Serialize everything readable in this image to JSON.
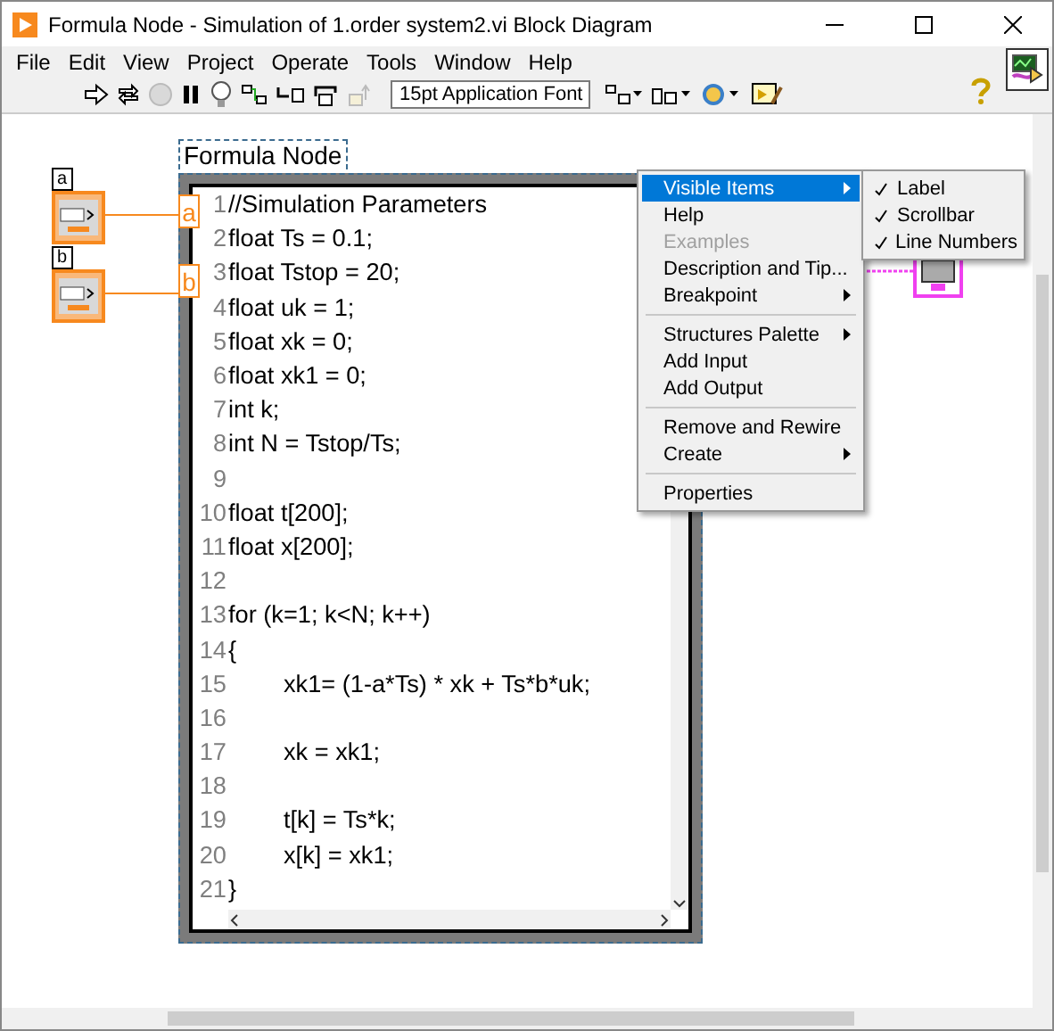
{
  "window": {
    "title": "Formula Node - Simulation of 1.order system2.vi Block Diagram"
  },
  "menu": [
    "File",
    "Edit",
    "View",
    "Project",
    "Operate",
    "Tools",
    "Window",
    "Help"
  ],
  "toolbar": {
    "font": "15pt Application Font"
  },
  "controls": [
    {
      "label": "a",
      "tunnel": "a"
    },
    {
      "label": "b",
      "tunnel": "b"
    }
  ],
  "formula_node": {
    "label": "Formula Node",
    "lines": [
      {
        "number": "1",
        "code": "//Simulation Parameters",
        "indent": false
      },
      {
        "number": "2",
        "code": "float Ts = 0.1;",
        "indent": false
      },
      {
        "number": "3",
        "code": "float Tstop = 20;",
        "indent": false
      },
      {
        "number": "4",
        "code": "float uk = 1;",
        "indent": false
      },
      {
        "number": "5",
        "code": "float xk = 0;",
        "indent": false
      },
      {
        "number": "6",
        "code": "float xk1 = 0;",
        "indent": false
      },
      {
        "number": "7",
        "code": "int k;",
        "indent": false
      },
      {
        "number": "8",
        "code": "int N = Tstop/Ts;",
        "indent": false
      },
      {
        "number": "9"
      },
      {
        "number": "10",
        "code": "float t[200];",
        "indent": false
      },
      {
        "number": "11",
        "code": "float x[200];",
        "indent": false
      },
      {
        "number": "12"
      },
      {
        "number": "13",
        "code": "for (k=1; k<N; k++)",
        "indent": false
      },
      {
        "number": "14",
        "code": "{",
        "indent": false
      },
      {
        "number": "15",
        "code": "xk1= (1-a*Ts) * xk + Ts*b*uk;",
        "indent": true
      },
      {
        "number": "16"
      },
      {
        "number": "17",
        "code": "xk = xk1;",
        "indent": true
      },
      {
        "number": "18"
      },
      {
        "number": "19",
        "code": "t[k] = Ts*k;",
        "indent": true
      },
      {
        "number": "20",
        "code": "x[k] = xk1;",
        "indent": true
      },
      {
        "number": "21",
        "code": "}",
        "indent": false
      }
    ]
  },
  "context_menu": [
    {
      "kind": "item",
      "label": "Visible Items",
      "submenu": true,
      "selected": true,
      "disabled": false
    },
    {
      "kind": "item",
      "label": "Help",
      "submenu": false,
      "selected": false,
      "disabled": false
    },
    {
      "kind": "item",
      "label": "Examples",
      "submenu": false,
      "selected": false,
      "disabled": true
    },
    {
      "kind": "item",
      "label": "Description and Tip...",
      "submenu": false,
      "selected": false,
      "disabled": false
    },
    {
      "kind": "item",
      "label": "Breakpoint",
      "submenu": true,
      "selected": false,
      "disabled": false
    },
    {
      "kind": "separator"
    },
    {
      "kind": "item",
      "label": "Structures Palette",
      "submenu": true,
      "selected": false,
      "disabled": false
    },
    {
      "kind": "item",
      "label": "Add Input",
      "submenu": false,
      "selected": false,
      "disabled": false
    },
    {
      "kind": "item",
      "label": "Add Output",
      "submenu": false,
      "selected": false,
      "disabled": false
    },
    {
      "kind": "separator"
    },
    {
      "kind": "item",
      "label": "Remove and Rewire",
      "submenu": false,
      "selected": false,
      "disabled": false
    },
    {
      "kind": "item",
      "label": "Create",
      "submenu": true,
      "selected": false,
      "disabled": false
    },
    {
      "kind": "separator"
    },
    {
      "kind": "item",
      "label": "Properties",
      "submenu": false,
      "selected": false,
      "disabled": false
    }
  ],
  "visible_items_menu": [
    {
      "label": "Label",
      "checked": true
    },
    {
      "label": "Scrollbar",
      "checked": true
    },
    {
      "label": "Line Numbers",
      "checked": true
    }
  ]
}
